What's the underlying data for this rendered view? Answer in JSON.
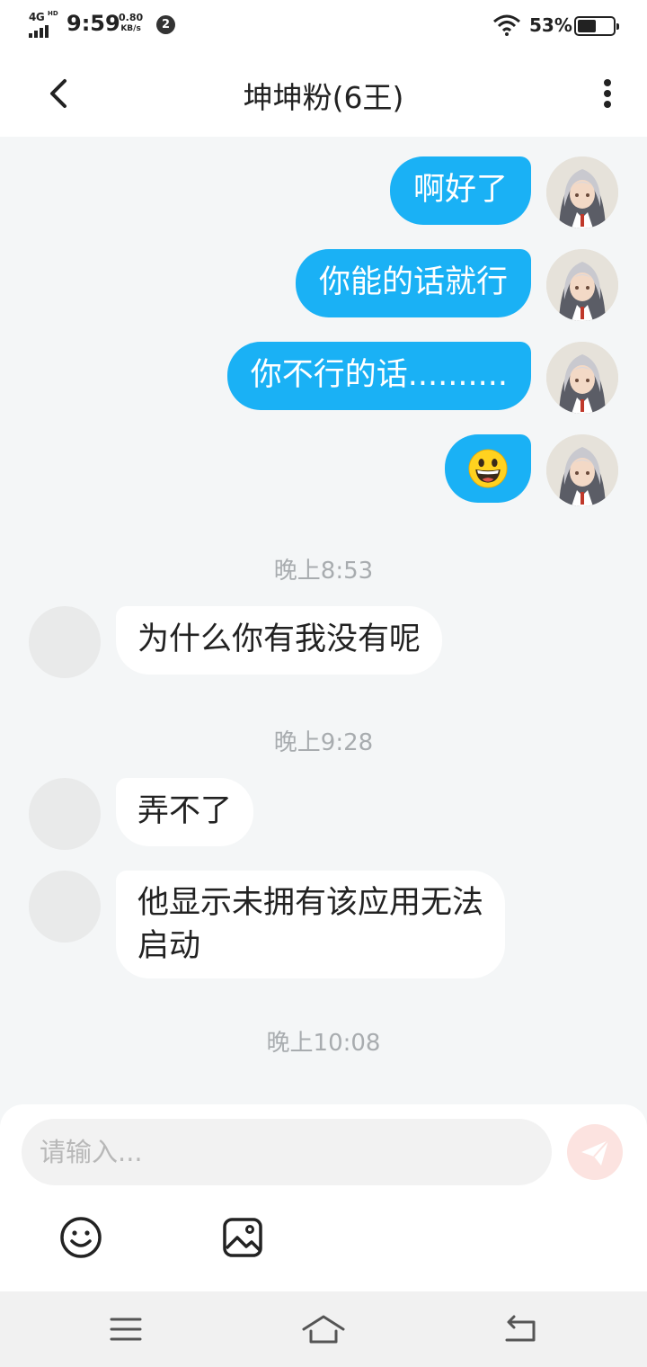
{
  "status_bar": {
    "network_type": "4G",
    "network_hd": "HD",
    "time": "9:59",
    "speed_value": "0.80",
    "speed_unit": "KB/s",
    "notification_count": "2",
    "battery_percent": "53%",
    "battery_level": 0.53
  },
  "header": {
    "title": "坤坤粉(6王)",
    "back_icon": "chevron-left-icon",
    "more_icon": "more-vertical-icon"
  },
  "messages": {
    "outgoing": [
      {
        "text": "啊好了"
      },
      {
        "text": "你能的话就行"
      },
      {
        "text": "你不行的话.........."
      },
      {
        "text": "",
        "emoji": "grinning-face"
      }
    ],
    "timestamps": [
      "晚上8:53",
      "晚上9:28",
      "晚上10:08"
    ],
    "incoming": [
      {
        "text": "为什么你有我没有呢"
      },
      {
        "text": "弄不了"
      },
      {
        "line1": "他显示未拥有该应用无法",
        "line2": "启动"
      }
    ]
  },
  "composer": {
    "placeholder": "请输入...",
    "send_icon": "send-icon",
    "emoji_icon": "smiley-icon",
    "image_icon": "image-icon"
  },
  "colors": {
    "outgoing_bubble": "#1ab1f5",
    "incoming_bubble": "#ffffff",
    "chat_background": "#f4f6f7",
    "send_button": "#fce3e0"
  }
}
